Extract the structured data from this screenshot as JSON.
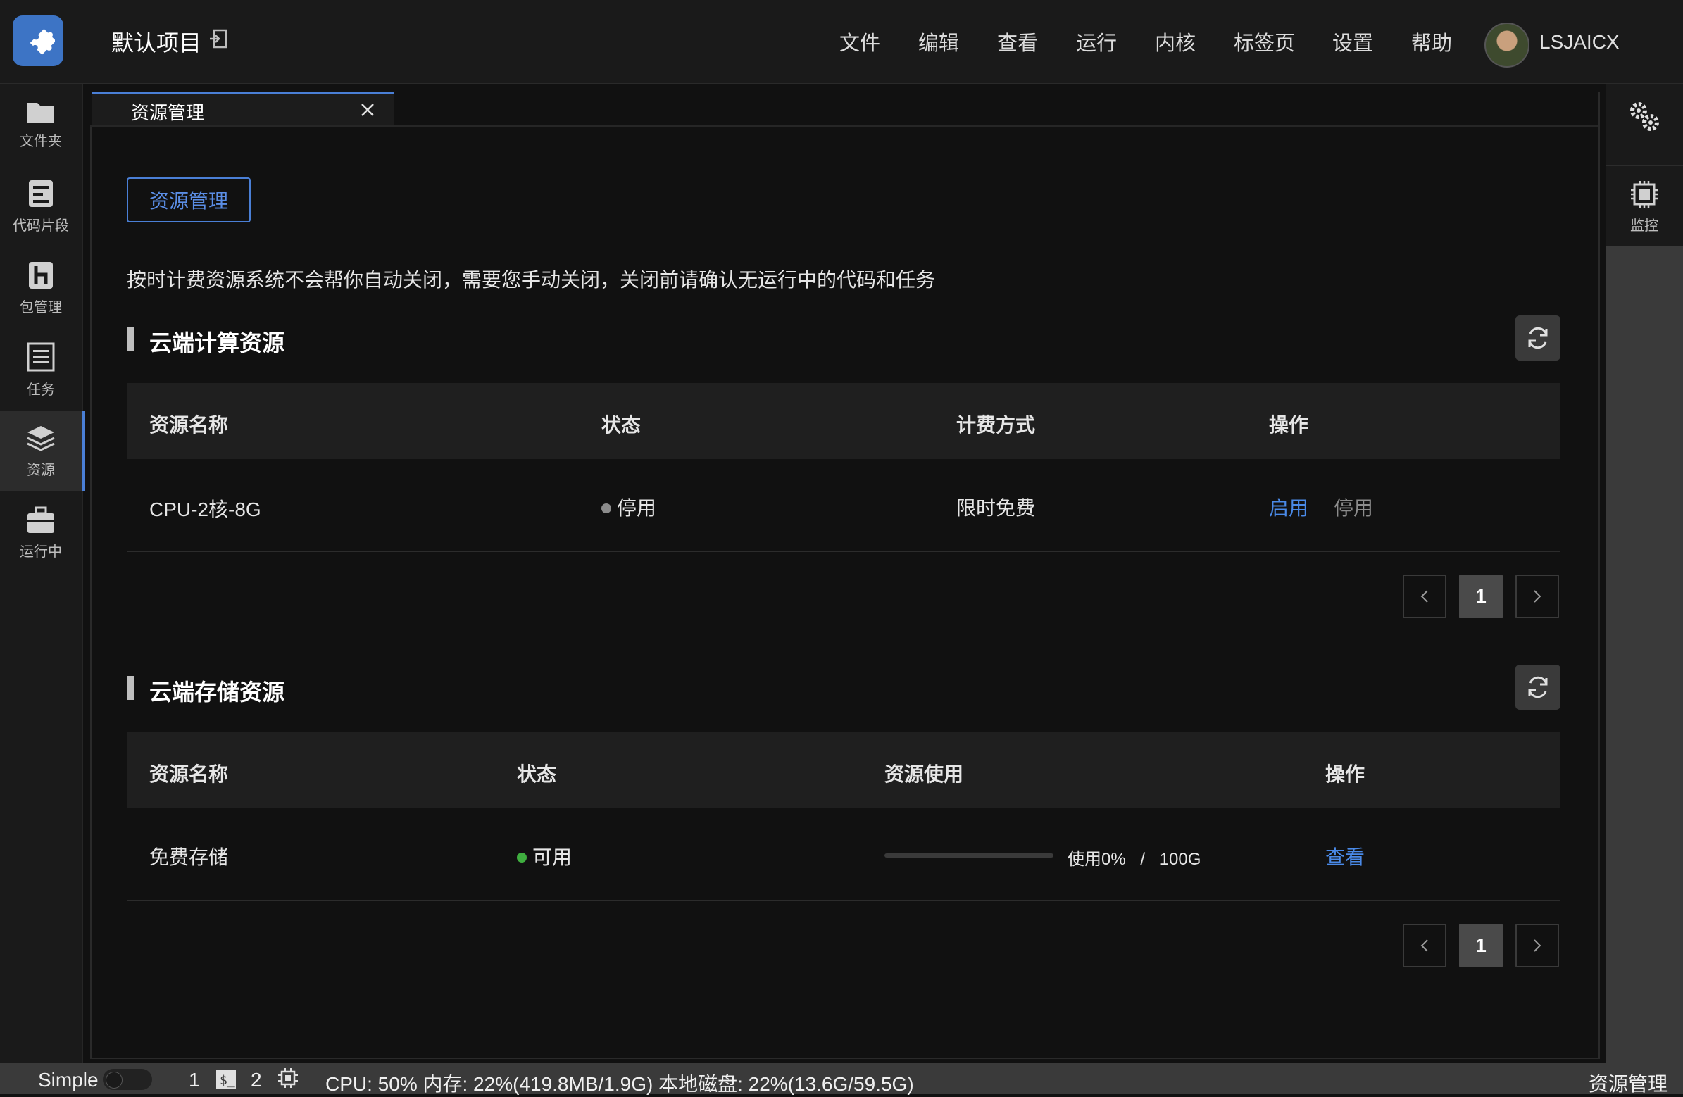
{
  "header": {
    "project_title": "默认项目",
    "menu": [
      "文件",
      "编辑",
      "查看",
      "运行",
      "内核",
      "标签页",
      "设置",
      "帮助"
    ],
    "username": "LSJAICX"
  },
  "sidebar": {
    "items": [
      {
        "label": "文件夹",
        "icon": "folder-icon"
      },
      {
        "label": "代码片段",
        "icon": "code-snippet-icon"
      },
      {
        "label": "包管理",
        "icon": "package-icon"
      },
      {
        "label": "任务",
        "icon": "task-list-icon"
      },
      {
        "label": "资源",
        "icon": "layers-icon",
        "active": true
      },
      {
        "label": "运行中",
        "icon": "briefcase-icon"
      }
    ]
  },
  "right_sidebar": {
    "items": [
      {
        "label": "",
        "icon": "gears-icon"
      },
      {
        "label": "监控",
        "icon": "chip-icon"
      }
    ]
  },
  "tab": {
    "title": "资源管理"
  },
  "page": {
    "button_label": "资源管理",
    "notice": "按时计费资源系统不会帮你自动关闭，需要您手动关闭，关闭前请确认无运行中的代码和任务"
  },
  "compute": {
    "title": "云端计算资源",
    "headers": [
      "资源名称",
      "状态",
      "计费方式",
      "操作"
    ],
    "row": {
      "name": "CPU-2核-8G",
      "status": "停用",
      "status_color": "#8c8c8c",
      "billing": "限时免费",
      "action_enable": "启用",
      "action_disable": "停用"
    },
    "page_current": "1"
  },
  "storage": {
    "title": "云端存储资源",
    "headers": [
      "资源名称",
      "状态",
      "资源使用",
      "操作"
    ],
    "row": {
      "name": "免费存储",
      "status": "可用",
      "status_color": "#3fae3f",
      "usage_label": "使用0%",
      "usage_sep": "/",
      "usage_total": "100G",
      "usage_fraction": 0,
      "action_view": "查看"
    },
    "page_current": "1"
  },
  "statusbar": {
    "mode": "Simple",
    "count1": "1",
    "count2": "2",
    "stats": "CPU:  50% 内存:  22%(419.8MB/1.9G) 本地磁盘:  22%(13.6G/59.5G)",
    "right": "资源管理"
  },
  "colors": {
    "accent": "#4a7fd6",
    "link": "#4a8ae8"
  }
}
